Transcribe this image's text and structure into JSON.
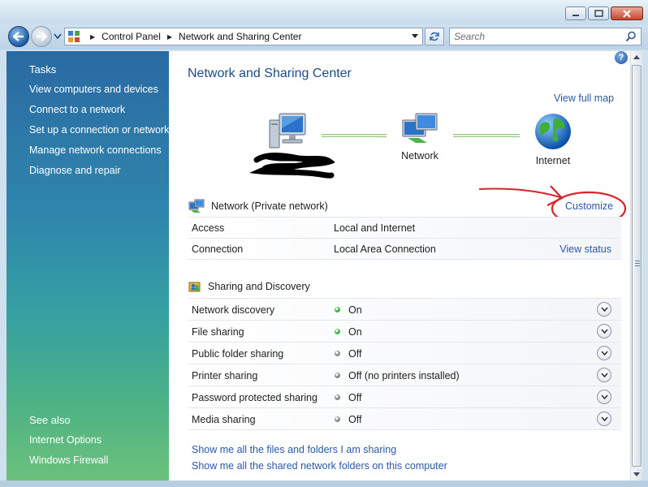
{
  "window": {
    "controls": [
      "minimize-icon",
      "maximize-icon",
      "close-icon"
    ]
  },
  "nav": {
    "breadcrumb": [
      "Control Panel",
      "Network and Sharing Center"
    ],
    "search_placeholder": "Search"
  },
  "left_pane": {
    "tasks_heading": "Tasks",
    "tasks": [
      "View computers and devices",
      "Connect to a network",
      "Set up a connection or network",
      "Manage network connections",
      "Diagnose and repair"
    ],
    "see_also_heading": "See also",
    "see_also": [
      "Internet Options",
      "Windows Firewall"
    ]
  },
  "main": {
    "title": "Network and Sharing Center",
    "view_full_map": "View full map",
    "map": {
      "nodes": [
        "Network",
        "Internet"
      ]
    },
    "network": {
      "name": "Network (Private network)",
      "customize": "Customize",
      "rows": [
        {
          "label": "Access",
          "value": "Local and Internet",
          "link": ""
        },
        {
          "label": "Connection",
          "value": "Local Area Connection",
          "link": "View status"
        }
      ]
    },
    "sharing": {
      "heading": "Sharing and Discovery",
      "rows": [
        {
          "label": "Network discovery",
          "status": "On",
          "state_color": "#3bb84a"
        },
        {
          "label": "File sharing",
          "status": "On",
          "state_color": "#3bb84a"
        },
        {
          "label": "Public folder sharing",
          "status": "Off",
          "state_color": "#8a8a8a"
        },
        {
          "label": "Printer sharing",
          "status": "Off (no printers installed)",
          "state_color": "#8a8a8a"
        },
        {
          "label": "Password protected sharing",
          "status": "Off",
          "state_color": "#8a8a8a"
        },
        {
          "label": "Media sharing",
          "status": "Off",
          "state_color": "#8a8a8a"
        }
      ]
    },
    "links": [
      "Show me all the files and folders I am sharing",
      "Show me all the shared network folders on this computer"
    ]
  },
  "colors": {
    "link": "#2a58a6",
    "title": "#1c4a8a",
    "annotation": "#d9232a"
  }
}
